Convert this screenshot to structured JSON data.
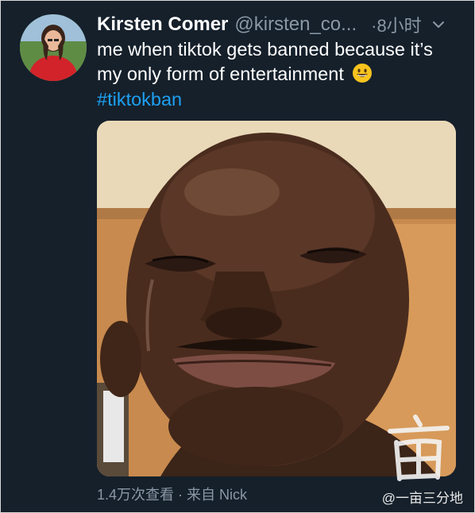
{
  "tweet": {
    "author_name": "Kirsten Comer",
    "handle": "@kirsten_co...",
    "time": "·8小时",
    "text": "me when tiktok gets banned because it’s my only form of entertainment",
    "emoji": "grinning-face-emoji",
    "hashtag": "#tiktokban",
    "footer": "1.4万次查看 · 来自 Nick"
  },
  "icons": {
    "more": "chevron-down-icon"
  },
  "watermark": {
    "text": "@一亩三分地",
    "seal": "亩"
  },
  "colors": {
    "background": "#15202b",
    "text": "#ffffff",
    "muted": "#8b98a5",
    "link": "#1da1f2"
  }
}
